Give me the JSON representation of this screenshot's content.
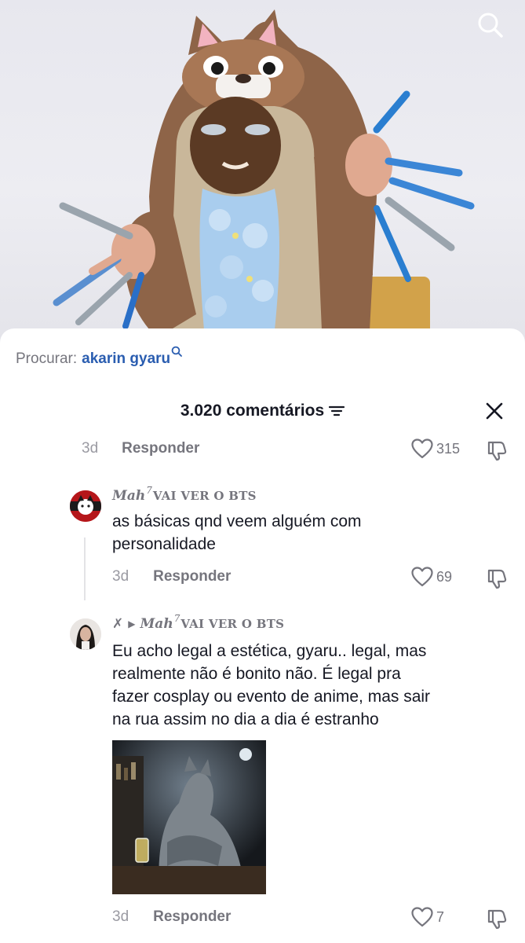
{
  "video": {
    "search_icon": "search-icon"
  },
  "search": {
    "prefix": "Procurar:",
    "query": "akarin gyaru"
  },
  "comments_header": {
    "title": "3.020 comentários",
    "sort_icon": "sort-lines-icon",
    "close_icon": "close-icon"
  },
  "comments": [
    {
      "date": "3d",
      "reply_label": "Responder",
      "likes": "315"
    },
    {
      "user_name": "Mah",
      "user_sup": "7",
      "user_tag": "VAI VER O BTS",
      "text_line1": "as básicas qnd veem alguém com",
      "text_line2": "personalidade",
      "date": "3d",
      "reply_label": "Responder",
      "likes": "69"
    },
    {
      "prefix_mark": "✗",
      "reply_to_name": "Mah",
      "reply_to_sup": "7",
      "reply_to_tag": "VAI VER O BTS",
      "text_line1": "Eu acho legal a estética, gyaru.. legal, mas",
      "text_line2": "realmente não é bonito não. É legal pra",
      "text_line3": "fazer cosplay ou evento de anime, mas sair",
      "text_line4": "na rua assim no dia a dia é estranho",
      "date": "3d",
      "reply_label": "Responder",
      "likes": "7"
    }
  ],
  "colors": {
    "text_primary": "#161823",
    "text_secondary": "#75757d",
    "link_blue": "#2a5db0",
    "divider": "#e3e3e6"
  }
}
